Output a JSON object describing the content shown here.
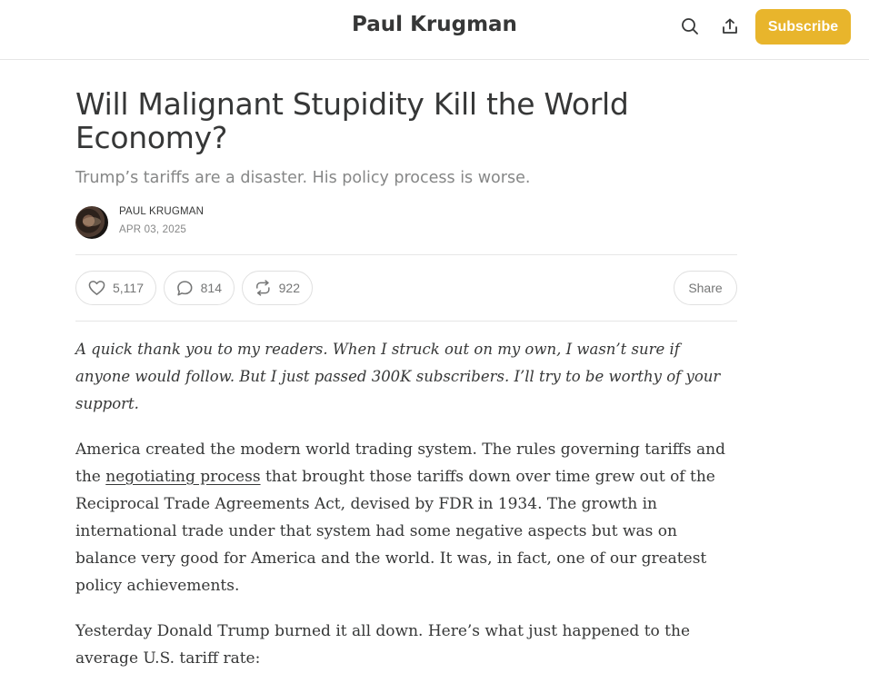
{
  "header": {
    "publication_name": "Paul Krugman",
    "search_icon": "search-icon",
    "share_icon": "share-upload-icon",
    "subscribe_label": "Subscribe",
    "accent_color": "#e8b52c"
  },
  "article": {
    "title": "Will Malignant Stupidity Kill the World Economy?",
    "subtitle": "Trump’s tariffs are a disaster. His policy process is worse.",
    "author": "PAUL KRUGMAN",
    "date": "APR 03, 2025",
    "actions": {
      "likes": "5,117",
      "comments": "814",
      "restacks": "922",
      "share_label": "Share"
    },
    "intro_italic": "A quick thank you to my readers. When I struck out on my own, I wasn’t sure if anyone would follow. But I just passed 300K subscribers. I’ll try to be worthy of your support.",
    "paragraph1_before_link": "America created the modern world trading system. The rules governing tariffs and the ",
    "paragraph1_link": "negotiating process",
    "paragraph1_after_link": " that brought those tariffs down over time grew out of the Reciprocal Trade Agreements Act, devised by FDR in 1934. The growth in international trade under that system had some negative aspects but was on balance very good for America and the world. It was, in fact, one of our greatest policy achievements.",
    "paragraph2": "Yesterday Donald Trump burned it all down. Here’s what just happened to the average U.S. tariff rate:"
  }
}
